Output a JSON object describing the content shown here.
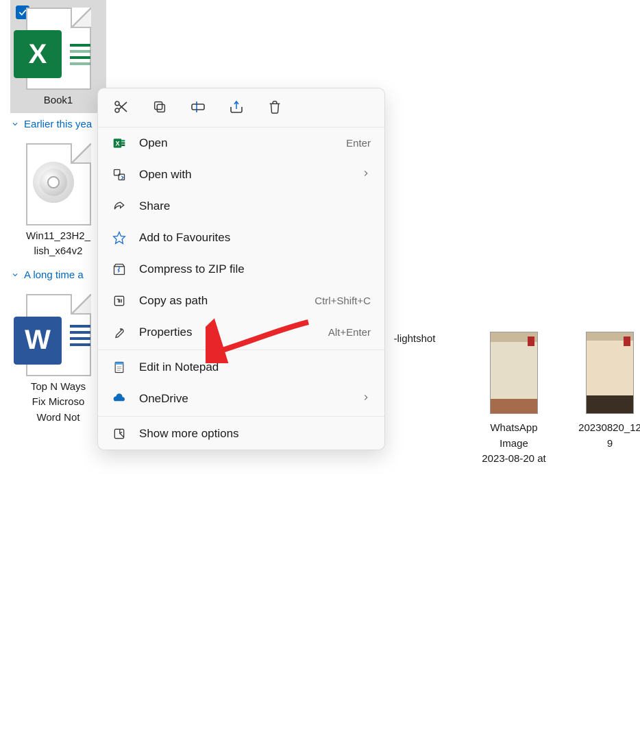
{
  "groups": {
    "earlier_this_year": "Earlier this yea",
    "long_time_ago": "A long time a"
  },
  "files": {
    "book1": "Book1",
    "win11": "Win11_23H2_\nlish_x64v2",
    "topn": "Top N Ways\nFix Microso\nWord Not",
    "lightshot": "-lightshot",
    "whatsapp": "WhatsApp\nImage\n2023-08-20 at",
    "photo": "20230820_12\n9"
  },
  "menu": {
    "open": "Open",
    "open_hint": "Enter",
    "open_with": "Open with",
    "share": "Share",
    "favourites": "Add to Favourites",
    "compress": "Compress to ZIP file",
    "copy_path": "Copy as path",
    "copy_path_hint": "Ctrl+Shift+C",
    "properties": "Properties",
    "properties_hint": "Alt+Enter",
    "notepad": "Edit in Notepad",
    "onedrive": "OneDrive",
    "more": "Show more options"
  }
}
